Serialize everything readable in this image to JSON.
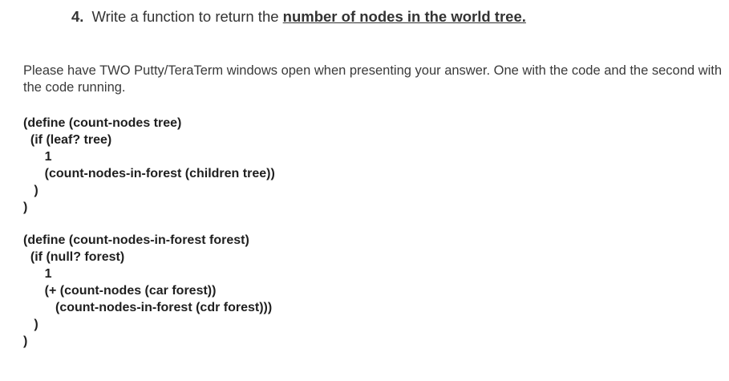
{
  "question": {
    "number": "4.",
    "prefix": "Write a function to return the ",
    "emphasis": "number of nodes in the world tree."
  },
  "instructions": "Please have TWO Putty/TeraTerm windows open when presenting your answer. One with the code and the second with the code running.",
  "code_blocks": [
    {
      "lines": [
        "(define (count-nodes tree)",
        "  (if (leaf? tree)",
        "      1",
        "      (count-nodes-in-forest (children tree))",
        "   )",
        ")"
      ]
    },
    {
      "lines": [
        "(define (count-nodes-in-forest forest)",
        "  (if (null? forest)",
        "      1",
        "      (+ (count-nodes (car forest))",
        "         (count-nodes-in-forest (cdr forest)))",
        "   )",
        ")"
      ]
    }
  ]
}
